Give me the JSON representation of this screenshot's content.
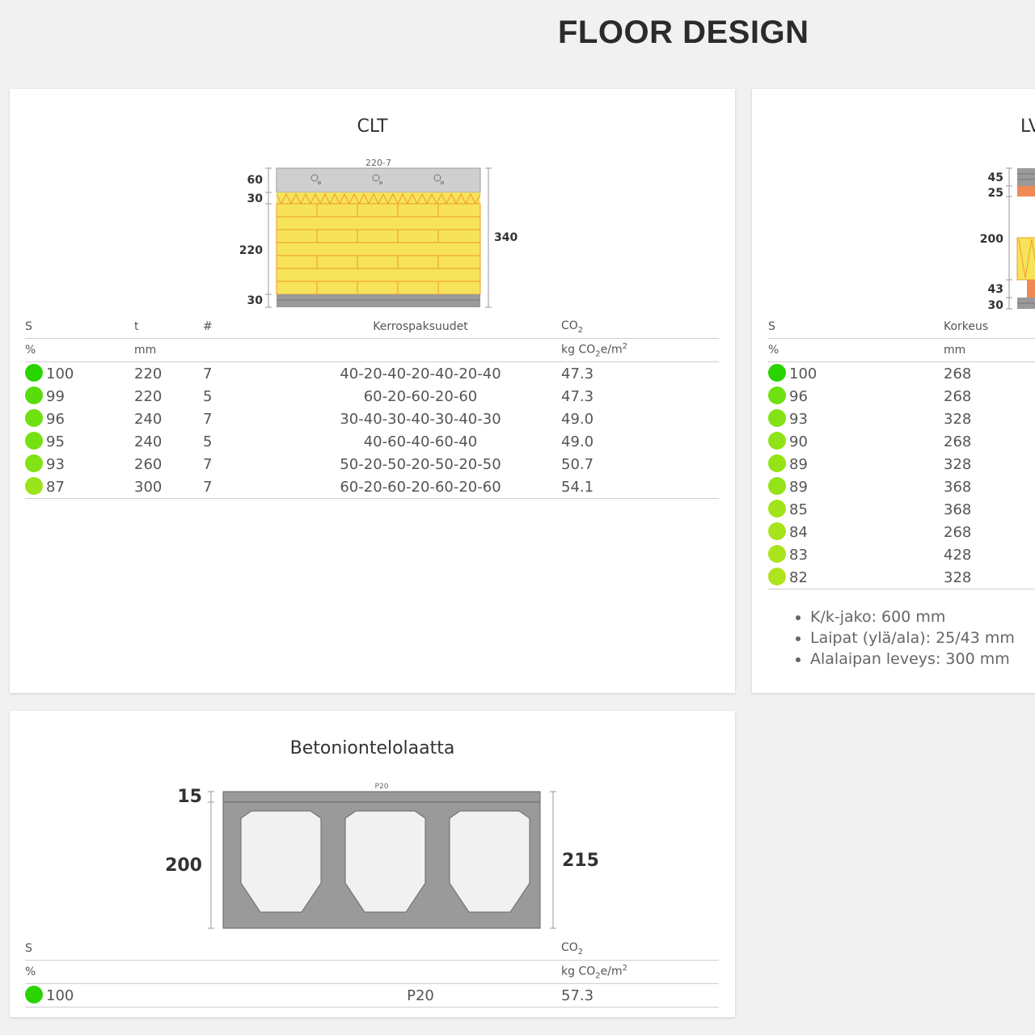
{
  "page_title": "FLOOR DESIGN",
  "colors": {
    "best": "#2ad400",
    "good": "#9be31a",
    "clt_yellow": "#f7e35a",
    "clt_line": "#ee9a2e",
    "concrete": "#9a9a9a",
    "screed": "#cfcfcf",
    "lvl_orange": "#f08a55"
  },
  "clt": {
    "title": "CLT",
    "diagram": {
      "top_label": "220-7",
      "dims_left": [
        "60",
        "30",
        "220",
        "30"
      ],
      "dim_right": "340"
    },
    "headers": {
      "s": "S",
      "t": "t",
      "n": "#",
      "layers": "Kerrospaksuudet",
      "co2": "CO",
      "co2_sub": "2"
    },
    "units": {
      "s": "%",
      "t": "mm",
      "co2_pre": "kg CO",
      "co2_sub": "2",
      "co2_post": "e/m",
      "co2_sup": "2"
    },
    "rows": [
      {
        "s": "100",
        "t": "220",
        "n": "7",
        "layers": "40-20-40-20-40-20-40",
        "co2": "47.3",
        "color": "#2ad400"
      },
      {
        "s": "99",
        "t": "220",
        "n": "5",
        "layers": "60-20-60-20-60",
        "co2": "47.3",
        "color": "#58dc0b"
      },
      {
        "s": "96",
        "t": "240",
        "n": "7",
        "layers": "30-40-30-40-30-40-30",
        "co2": "49.0",
        "color": "#6fe010"
      },
      {
        "s": "95",
        "t": "240",
        "n": "5",
        "layers": "40-60-40-60-40",
        "co2": "49.0",
        "color": "#76e112"
      },
      {
        "s": "93",
        "t": "260",
        "n": "7",
        "layers": "50-20-50-20-50-20-50",
        "co2": "50.7",
        "color": "#82e214"
      },
      {
        "s": "87",
        "t": "300",
        "n": "7",
        "layers": "60-20-60-20-60-20-60",
        "co2": "54.1",
        "color": "#9be31a"
      }
    ]
  },
  "lvl": {
    "title": "LV",
    "diagram": {
      "dims_left": [
        "45",
        "25",
        "200",
        "43",
        "30"
      ]
    },
    "headers": {
      "s": "S",
      "h": "Korkeus"
    },
    "units": {
      "s": "%",
      "h": "mm"
    },
    "rows": [
      {
        "s": "100",
        "h": "268",
        "color": "#2ad400"
      },
      {
        "s": "96",
        "h": "268",
        "color": "#6fe010"
      },
      {
        "s": "93",
        "h": "328",
        "color": "#82e214"
      },
      {
        "s": "90",
        "h": "268",
        "color": "#8fe216"
      },
      {
        "s": "89",
        "h": "328",
        "color": "#94e317"
      },
      {
        "s": "89",
        "h": "368",
        "color": "#94e317"
      },
      {
        "s": "85",
        "h": "368",
        "color": "#a2e41b"
      },
      {
        "s": "84",
        "h": "268",
        "color": "#a6e41c"
      },
      {
        "s": "83",
        "h": "428",
        "color": "#aae41d"
      },
      {
        "s": "82",
        "h": "328",
        "color": "#aee41e"
      }
    ],
    "notes": [
      "K/k-jako: 600 mm",
      "Laipat (ylä/ala): 25/43 mm",
      "Alalaipan leveys: 300 mm"
    ]
  },
  "hollowcore": {
    "title": "Betoniontelolaatta",
    "diagram": {
      "top_label": "P20",
      "dim_top": "15",
      "dim_left": "200",
      "dim_right": "215"
    },
    "headers": {
      "s": "S",
      "co2": "CO",
      "co2_sub": "2"
    },
    "units": {
      "s": "%",
      "co2_pre": "kg CO",
      "co2_sub": "2",
      "co2_post": "e/m",
      "co2_sup": "2"
    },
    "rows": [
      {
        "s": "100",
        "type": "P20",
        "co2": "57.3",
        "color": "#2ad400"
      }
    ]
  }
}
